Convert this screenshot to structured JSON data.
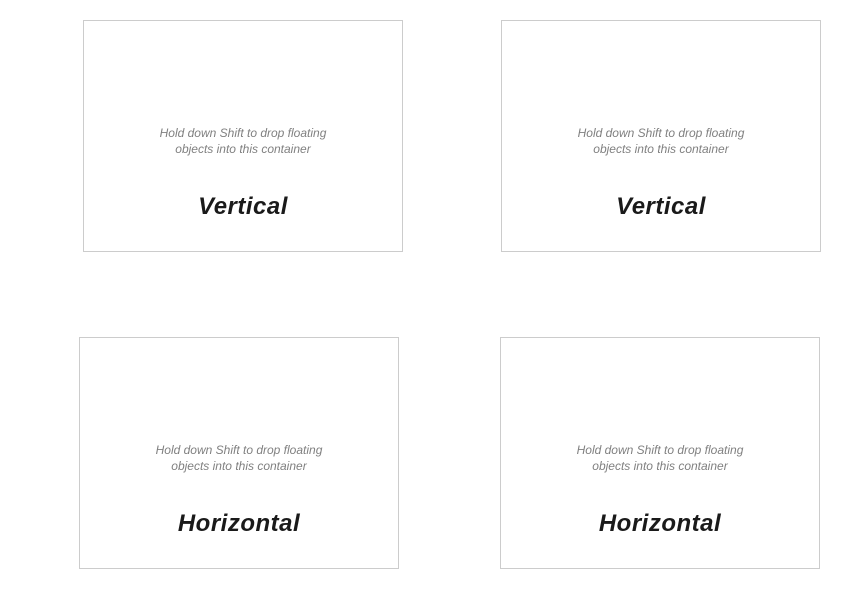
{
  "hint_text": "Hold down Shift to drop floating objects into this container",
  "containers": {
    "top_left": {
      "label": "Vertical"
    },
    "top_right": {
      "label": "Vertical"
    },
    "bottom_left": {
      "label": "Horizontal"
    },
    "bottom_right": {
      "label": "Horizontal"
    }
  }
}
